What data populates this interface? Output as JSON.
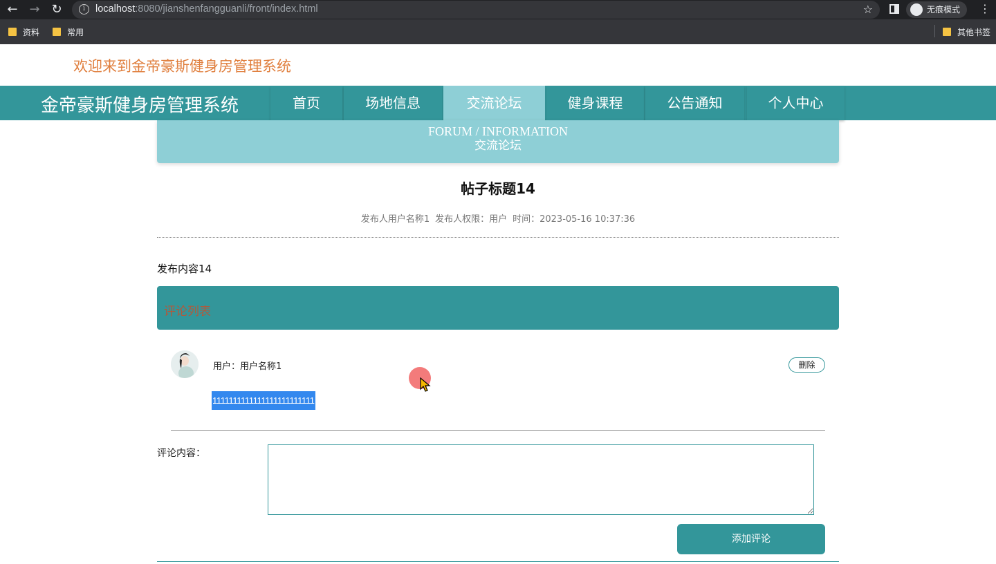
{
  "browser": {
    "url_host": "localhost",
    "url_rest": ":8080/jianshenfangguanli/front/index.html",
    "incognito_label": "无痕模式",
    "bookmarks": [
      "资料",
      "常用"
    ],
    "other_bookmarks": "其他书签"
  },
  "page": {
    "welcome": "欢迎来到金帝豪斯健身房管理系统",
    "brand": "金帝豪斯健身房管理系统"
  },
  "nav": {
    "items": [
      "首页",
      "场地信息",
      "交流论坛",
      "健身课程",
      "公告通知",
      "个人中心"
    ],
    "active": "交流论坛"
  },
  "banner": {
    "en": "FORUM / INFORMATION",
    "cn": "交流论坛"
  },
  "post": {
    "title": "帖子标题14",
    "author": "发布人用户名称1",
    "role": "发布人权限：用户",
    "time": "时间：2023-05-16 10:37:36",
    "content": "发布内容14"
  },
  "comments": {
    "header": "评论列表",
    "items": [
      {
        "user": "用户：用户名称1",
        "delete_label": "删除",
        "text": "1111111111111111111111111"
      }
    ]
  },
  "form": {
    "label": "评论内容：",
    "placeholder": "",
    "submit_label": "添加评论"
  },
  "colors": {
    "primary": "#33969a",
    "banner": "#8ecfd6",
    "welcome": "#e07f3e",
    "selection": "#3388ee"
  }
}
